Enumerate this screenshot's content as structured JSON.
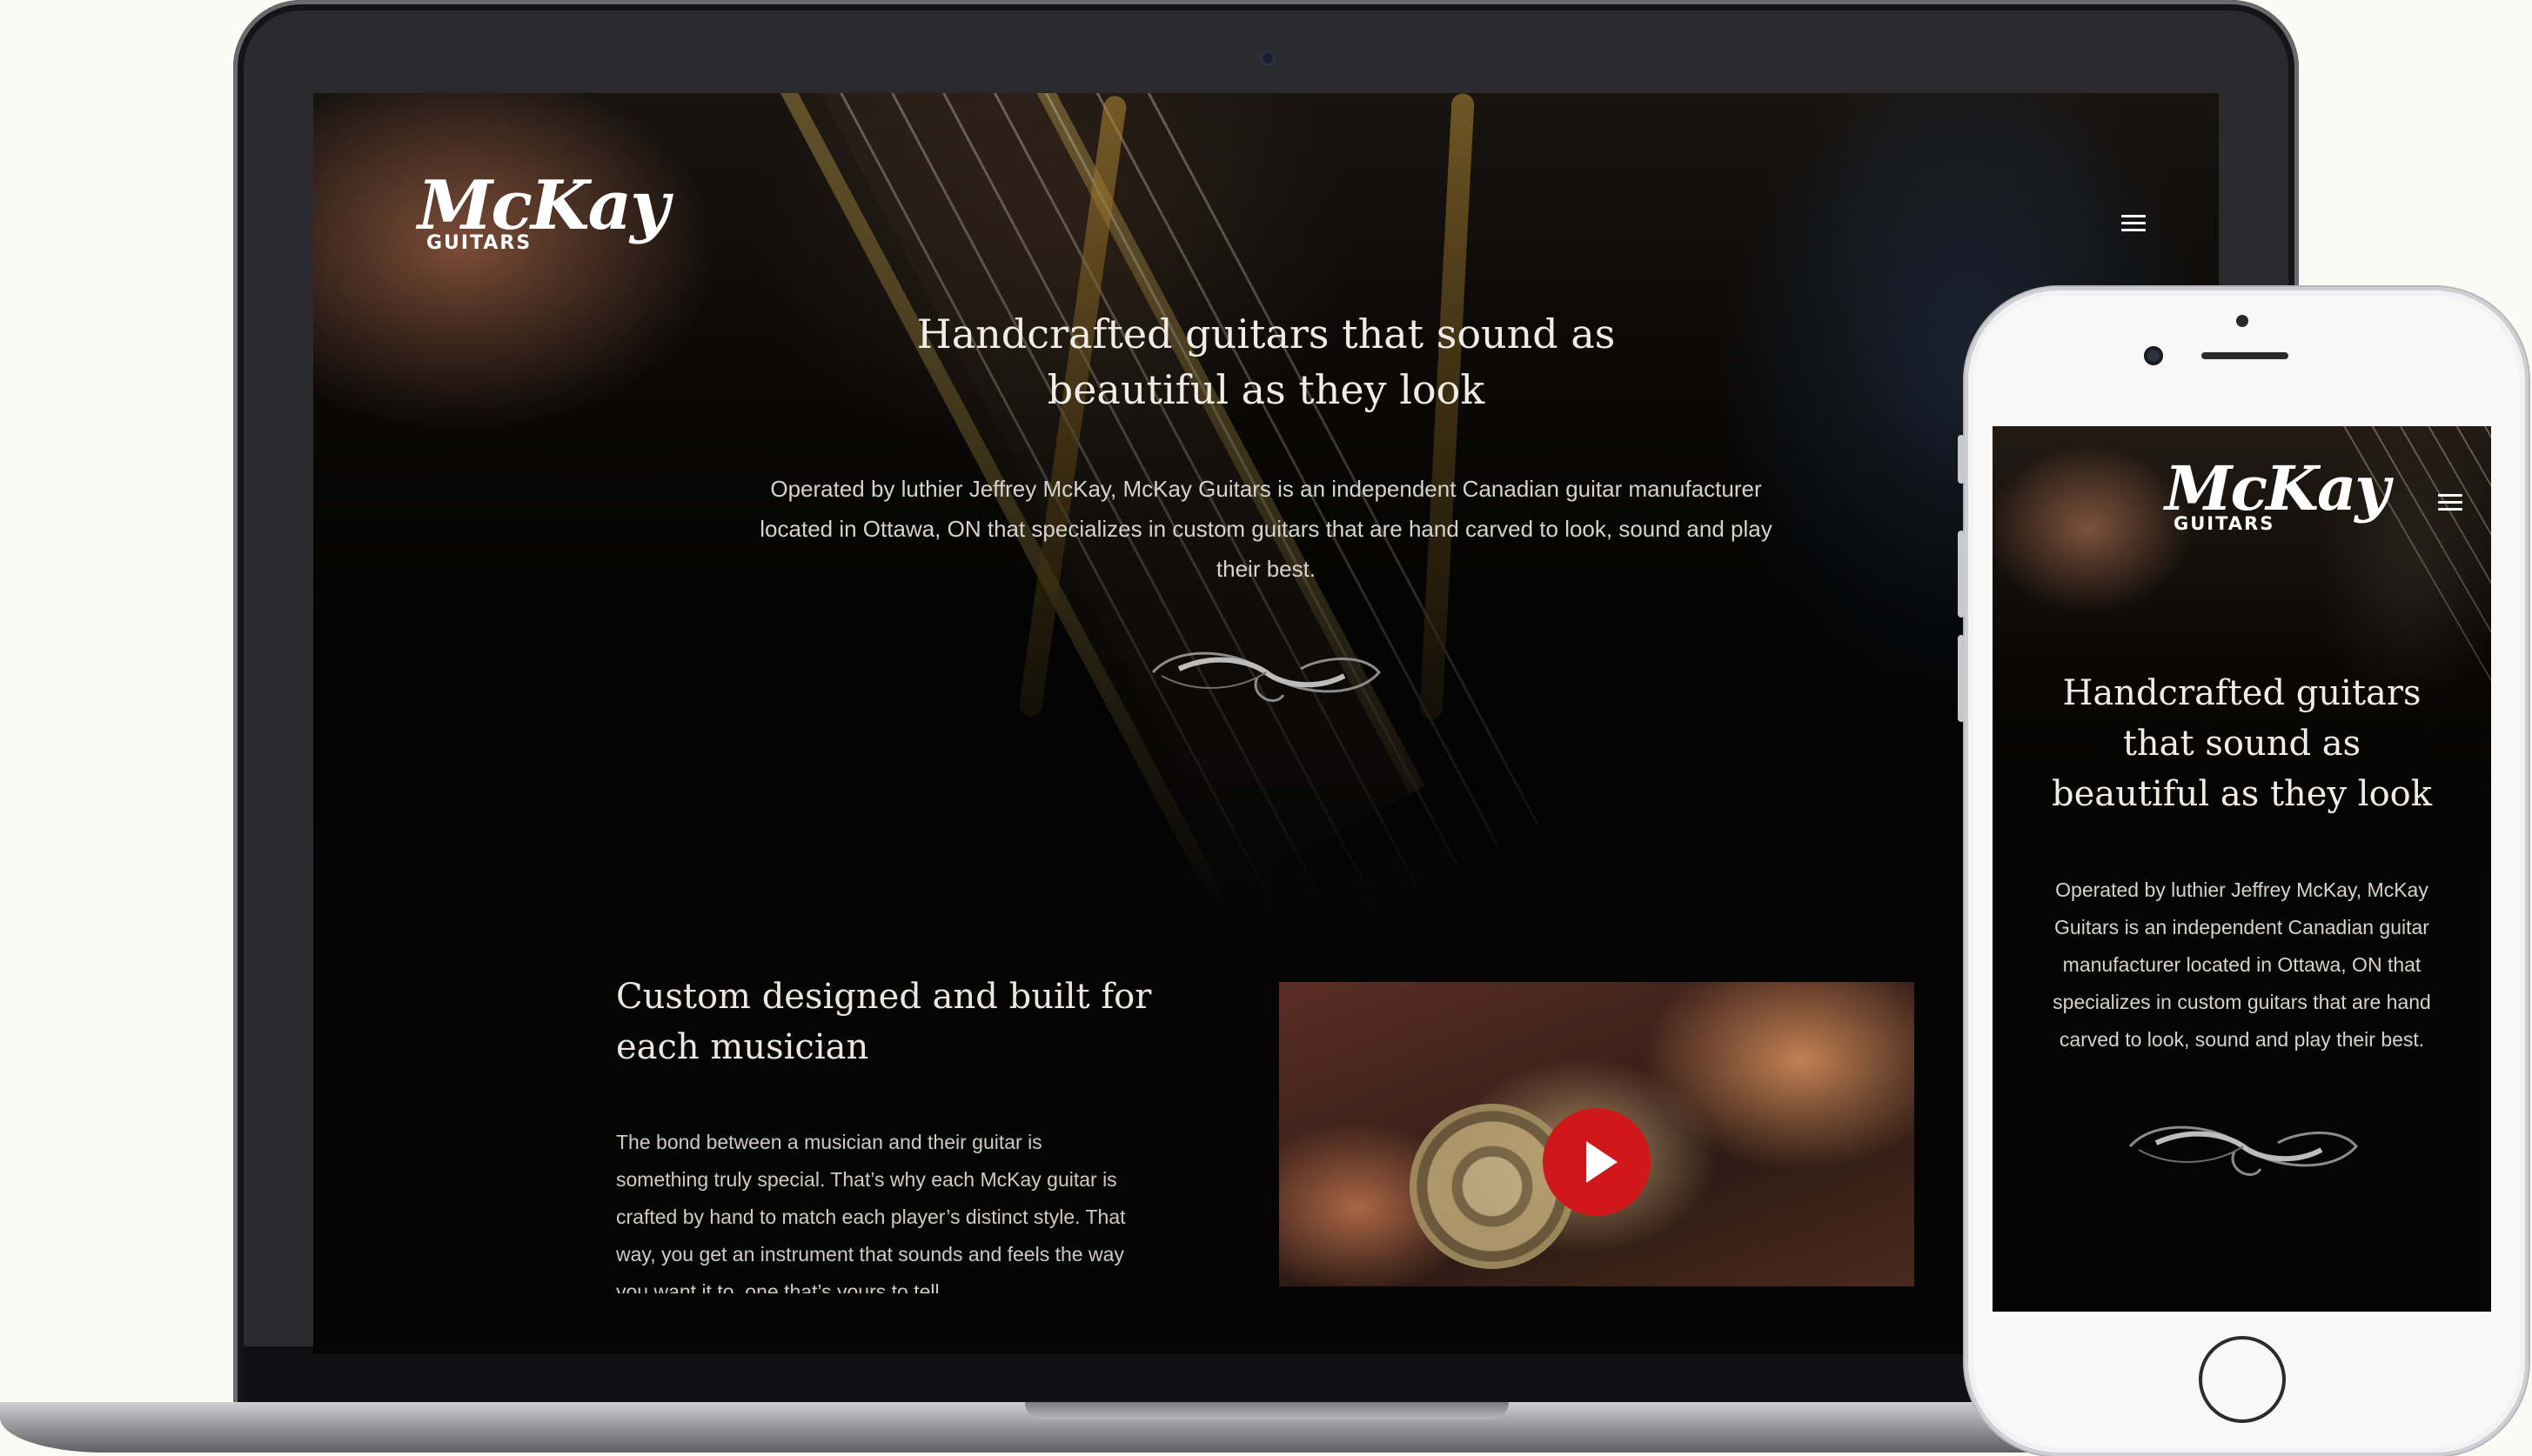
{
  "brand": {
    "script": "McKay",
    "sub": "GUITARS"
  },
  "hero": {
    "title_line1": "Handcrafted guitars that sound as",
    "title_line2": "beautiful as they look",
    "body": "Operated by luthier Jeffrey McKay, McKay Guitars is an independent Canadian guitar manufacturer located in Ottawa, ON that specializes in custom guitars that are hand carved to look, sound and play their best."
  },
  "section": {
    "title": "Custom designed and built for each musician",
    "body": "The bond between a musician and their guitar is something truly special. That’s why each McKay guitar is crafted by hand to match each player’s distinct style. That way, you get an instrument that sounds and feels the way you want it to, one that’s yours to tell."
  },
  "mobile": {
    "title_line1": "Handcrafted guitars",
    "title_line2": "that sound as",
    "title_line3": "beautiful as they look",
    "body": "Operated by luthier Jeffrey McKay, McKay Guitars is an independent Canadian guitar manufacturer located in Ottawa, ON that specializes in custom guitars that are hand carved to look, sound and play their best."
  },
  "icons": {
    "menu": "hamburger-menu-icon",
    "play": "play-icon",
    "flourish": "ornamental-flourish-icon"
  },
  "colors": {
    "play_button": "#d0181b",
    "background": "#050506",
    "text": "#f1ede6"
  }
}
